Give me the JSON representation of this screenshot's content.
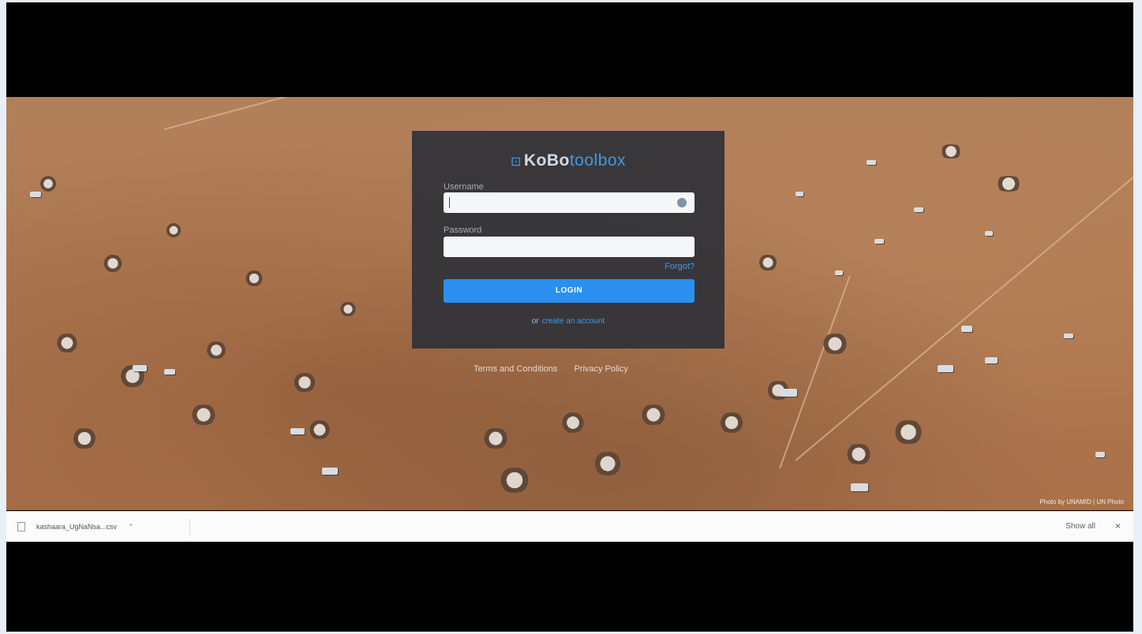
{
  "login": {
    "logo_box": "⊡",
    "logo_kobo": "KoBo",
    "logo_toolbox": "toolbox",
    "username_label": "Username",
    "password_label": "Password",
    "forgot_label": "Forgot?",
    "login_button": "LOGIN",
    "or_label": "or",
    "register_label": "create an account"
  },
  "footer": {
    "terms": "Terms and Conditions",
    "privacy": "Privacy Policy",
    "credit": "Photo by UNAMID | UN Photo"
  },
  "download_bar": {
    "file_name": "kashaara_UgNaNsa...csv",
    "show_all": "Show all",
    "close": "×"
  },
  "colors": {
    "panel": "#303238",
    "accent": "#2b8ff0",
    "ground": "#b07a52"
  }
}
